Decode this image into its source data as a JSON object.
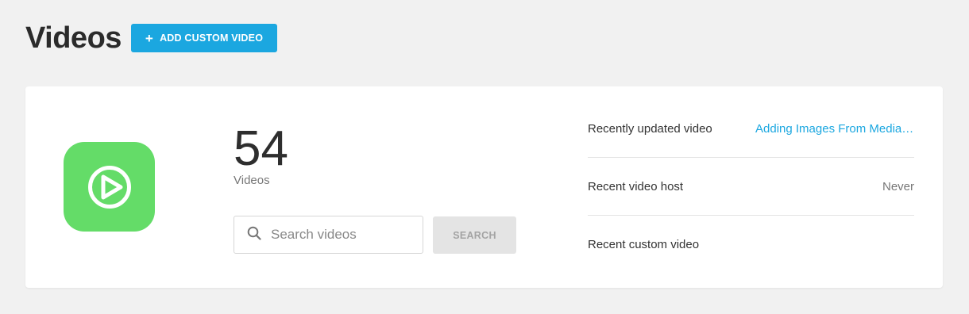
{
  "header": {
    "title": "Videos",
    "add_button_label": "ADD CUSTOM VIDEO",
    "add_button_icon": "+"
  },
  "summary": {
    "count": "54",
    "count_label": "Videos",
    "app_icon": "play-circle-icon",
    "icon_color": "#64dc68"
  },
  "search": {
    "placeholder": "Search videos",
    "value": "",
    "button_label": "SEARCH"
  },
  "stats": [
    {
      "label": "Recently updated video",
      "value": "Adding Images From Media ..."
    },
    {
      "label": "Recent video host",
      "value": "Never"
    },
    {
      "label": "Recent custom video",
      "value": ""
    }
  ],
  "colors": {
    "accent": "#1ba7e0",
    "background": "#f1f1f1"
  }
}
